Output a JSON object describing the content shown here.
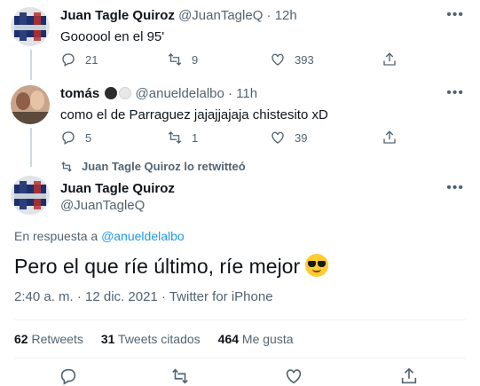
{
  "tweet1": {
    "name": "Juan Tagle Quiroz",
    "handle": "@JuanTagleQ",
    "time": "· 12h",
    "text": "Goooool en el 95'",
    "replies": "21",
    "retweets": "9",
    "likes": "393"
  },
  "tweet2": {
    "name": "tomás",
    "handle": "@anueldelalbo",
    "time": "· 11h",
    "text": "como el de Parraguez jajajjajaja chistesito xD",
    "replies": "5",
    "retweets": "1",
    "likes": "39"
  },
  "retweeted_note": "Juan Tagle Quiroz lo retwitteó",
  "main": {
    "name": "Juan Tagle Quiroz",
    "handle": "@JuanTagleQ",
    "reply_to_prefix": "En respuesta a",
    "reply_to_handle": "@anueldelalbo",
    "text": "Pero el que ríe último, ríe mejor",
    "timestamp": "2:40 a. m. · 12 dic. 2021 · Twitter for iPhone",
    "retweets_count": "62",
    "retweets_label": "Retweets",
    "quotes_count": "31",
    "quotes_label": "Tweets citados",
    "likes_count": "464",
    "likes_label": "Me gusta"
  },
  "icons": {
    "more": "more-icon",
    "reply": "reply-icon",
    "retweet": "retweet-icon",
    "like": "heart-icon",
    "share": "share-icon",
    "emoji": "sunglasses-emoji"
  },
  "colors": {
    "accent": "#1d9bf0",
    "muted": "#536471",
    "text": "#0f1419"
  }
}
